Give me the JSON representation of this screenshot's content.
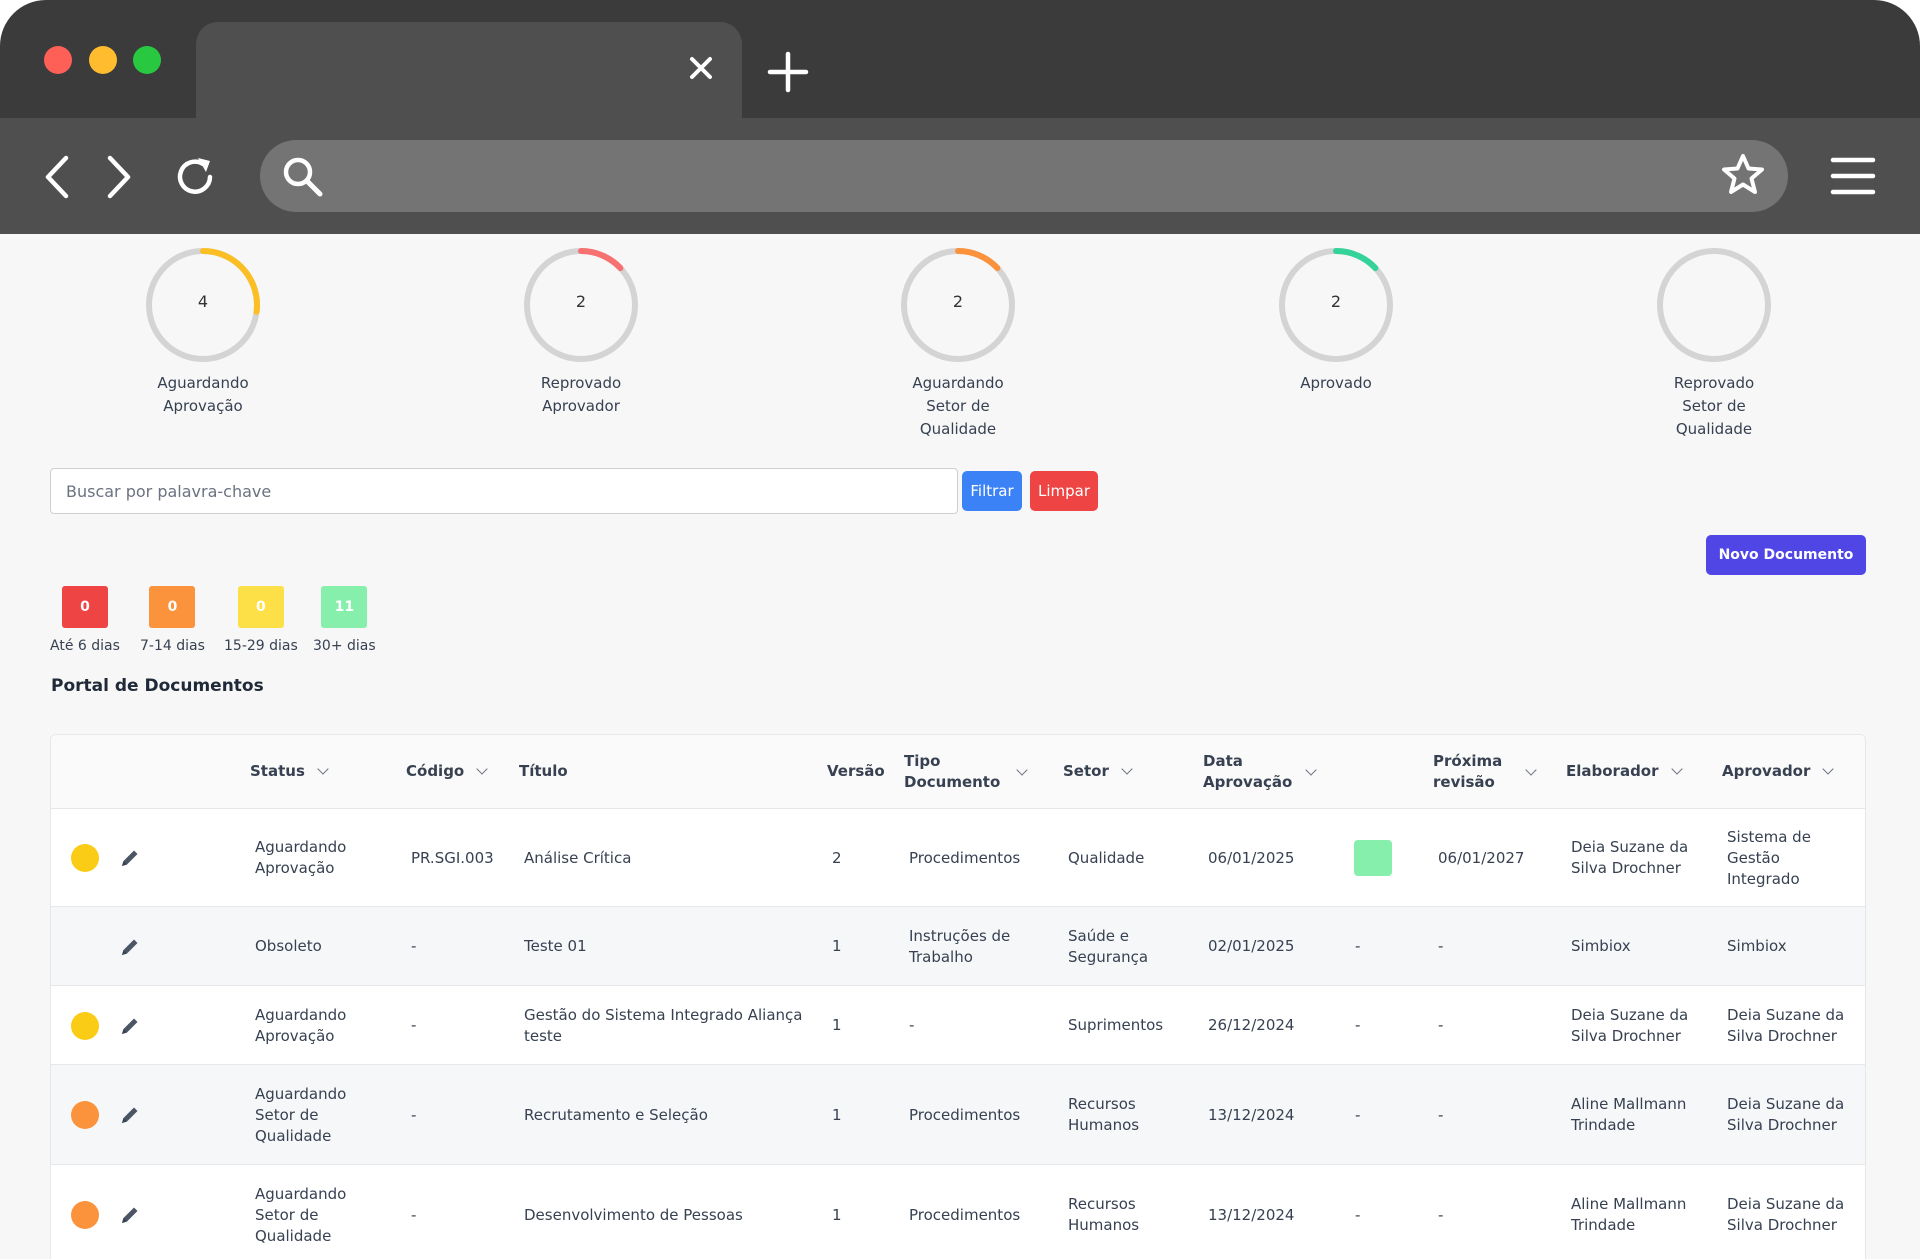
{
  "browser": {
    "icons": [
      "close-icon",
      "plus-icon",
      "back-icon",
      "forward-icon",
      "reload-icon",
      "search-icon",
      "star-icon",
      "menu-icon"
    ]
  },
  "gauges": [
    {
      "label": "Aguardando Aprovação",
      "value": "4",
      "color": "#fbbf24",
      "fraction": 0.27
    },
    {
      "label": "Reprovado Aprovador",
      "value": "2",
      "color": "#f87171",
      "fraction": 0.13
    },
    {
      "label": "Aguardando Setor de Qualidade",
      "value": "2",
      "color": "#fb923c",
      "fraction": 0.13
    },
    {
      "label": "Aprovado",
      "value": "2",
      "color": "#34d399",
      "fraction": 0.13
    },
    {
      "label": "Reprovado Setor de Qualidade",
      "value": "",
      "color": "#d4d4d4",
      "fraction": 0
    }
  ],
  "search": {
    "placeholder": "Buscar por palavra-chave"
  },
  "buttons": {
    "filter": "Filtrar",
    "clear": "Limpar",
    "new_document": "Novo Documento"
  },
  "deadline_counters": [
    {
      "label": "Até 6 dias",
      "count": "0",
      "color": "#ef4444"
    },
    {
      "label": "7-14 dias",
      "count": "0",
      "color": "#fb923c"
    },
    {
      "label": "15-29 dias",
      "count": "0",
      "color": "#fde047"
    },
    {
      "label": "30+ dias",
      "count": "11",
      "color": "#86efac"
    }
  ],
  "portal_title": "Portal de Documentos",
  "table": {
    "headers": {
      "status": "Status",
      "codigo": "Código",
      "titulo": "Título",
      "versao": "Versão",
      "tipo": "Tipo Documento",
      "setor": "Setor",
      "data_aprovacao": "Data Aprovação",
      "proxima_revisao": "Próxima revisão",
      "elaborador": "Elaborador",
      "aprovador": "Aprovador"
    },
    "rows": [
      {
        "status_color": "#facc15",
        "status": "Aguardando Aprovação",
        "codigo": "PR.SGI.003",
        "titulo": "Análise Crítica",
        "versao": "2",
        "tipo": "Procedimentos",
        "setor": "Qualidade",
        "data_aprovacao": "06/01/2025",
        "badge_color": "#86efac",
        "badge_text": "",
        "proxima_revisao": "06/01/2027",
        "elaborador": "Deia Suzane da Silva Drochner",
        "aprovador": "Sistema de Gestão Integrado"
      },
      {
        "status_color": "",
        "status": "Obsoleto",
        "codigo": "-",
        "titulo": "Teste 01",
        "versao": "1",
        "tipo": "Instruções de Trabalho",
        "setor": "Saúde e Segurança",
        "data_aprovacao": "02/01/2025",
        "badge_color": "",
        "badge_text": "-",
        "proxima_revisao": "-",
        "elaborador": "Simbiox",
        "aprovador": "Simbiox"
      },
      {
        "status_color": "#facc15",
        "status": "Aguardando Aprovação",
        "codigo": "-",
        "titulo": "Gestão do Sistema Integrado Aliança teste",
        "versao": "1",
        "tipo": "-",
        "setor": "Suprimentos",
        "data_aprovacao": "26/12/2024",
        "badge_color": "",
        "badge_text": "-",
        "proxima_revisao": "-",
        "elaborador": "Deia Suzane da Silva Drochner",
        "aprovador": "Deia Suzane da Silva Drochner"
      },
      {
        "status_color": "#fb923c",
        "status": "Aguardando Setor de Qualidade",
        "codigo": "-",
        "titulo": "Recrutamento e Seleção",
        "versao": "1",
        "tipo": "Procedimentos",
        "setor": "Recursos Humanos",
        "data_aprovacao": "13/12/2024",
        "badge_color": "",
        "badge_text": "-",
        "proxima_revisao": "-",
        "elaborador": "Aline Mallmann Trindade",
        "aprovador": "Deia Suzane da Silva Drochner"
      },
      {
        "status_color": "#fb923c",
        "status": "Aguardando Setor de Qualidade",
        "codigo": "-",
        "titulo": "Desenvolvimento de Pessoas",
        "versao": "1",
        "tipo": "Procedimentos",
        "setor": "Recursos Humanos",
        "data_aprovacao": "13/12/2024",
        "badge_color": "",
        "badge_text": "-",
        "proxima_revisao": "-",
        "elaborador": "Aline Mallmann Trindade",
        "aprovador": "Deia Suzane da Silva Drochner"
      }
    ]
  }
}
